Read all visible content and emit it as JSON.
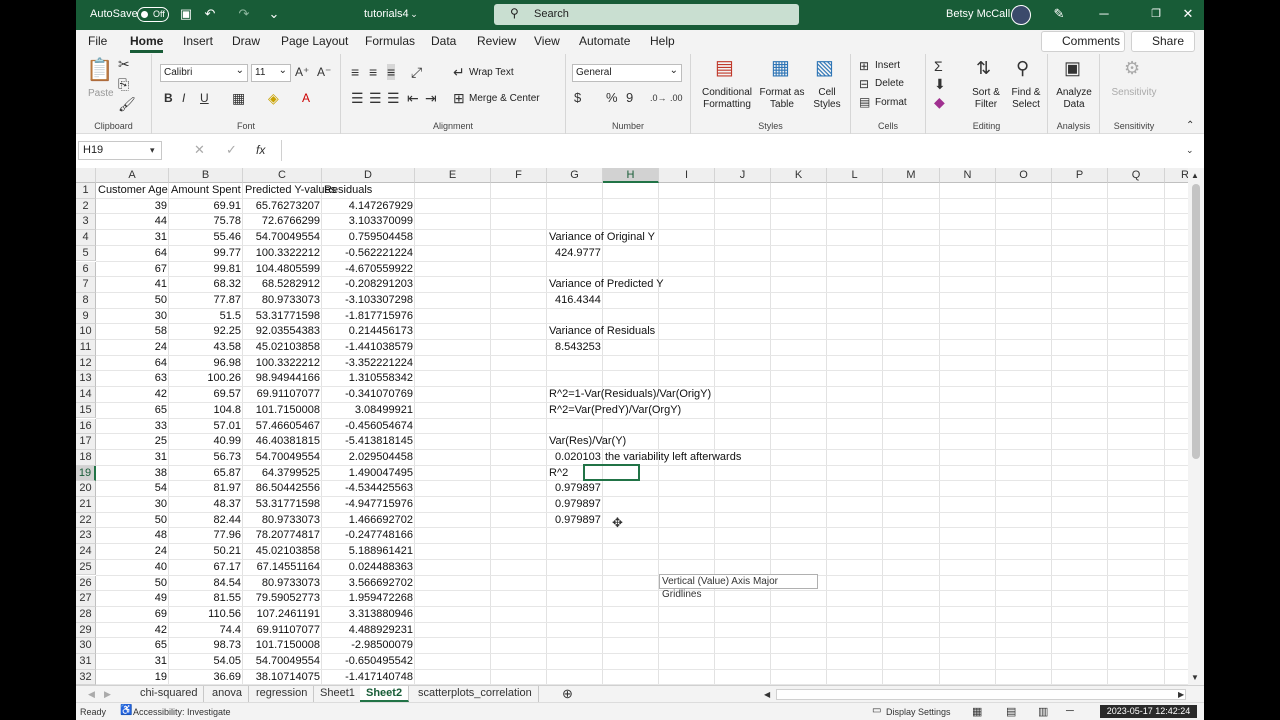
{
  "titlebar": {
    "autosave_label": "AutoSave",
    "autosave_state": "Off",
    "filename": "tutorials4",
    "search_placeholder": "Search",
    "user_name": "Betsy McCall"
  },
  "menu": [
    "File",
    "Home",
    "Insert",
    "Draw",
    "Page Layout",
    "Formulas",
    "Data",
    "Review",
    "View",
    "Automate",
    "Help"
  ],
  "menu_active": "Home",
  "comments_label": "Comments",
  "share_label": "Share",
  "ribbon": {
    "clipboard": {
      "label": "Clipboard",
      "paste": "Paste"
    },
    "font": {
      "label": "Font",
      "name": "Calibri",
      "size": "11"
    },
    "alignment": {
      "label": "Alignment",
      "wrap": "Wrap Text",
      "merge": "Merge & Center"
    },
    "number": {
      "label": "Number",
      "format": "General"
    },
    "styles": {
      "label": "Styles",
      "conditional": "Conditional",
      "conditional2": "Formatting",
      "format_as": "Format as",
      "format_as2": "Table",
      "cell": "Cell",
      "cell2": "Styles"
    },
    "cells": {
      "label": "Cells",
      "insert": "Insert",
      "delete": "Delete",
      "format": "Format"
    },
    "editing": {
      "label": "Editing",
      "sort": "Sort &",
      "sort2": "Filter",
      "find": "Find &",
      "find2": "Select"
    },
    "analysis": {
      "label": "Analysis",
      "analyze": "Analyze",
      "analyze2": "Data"
    },
    "sensitivity": {
      "label": "Sensitivity",
      "btn": "Sensitivity"
    }
  },
  "namebox": "H19",
  "fx": "fx",
  "columns": [
    "A",
    "B",
    "C",
    "D",
    "E",
    "F",
    "G",
    "H",
    "I",
    "J",
    "K",
    "L",
    "M",
    "N",
    "O",
    "P",
    "Q",
    "R"
  ],
  "selected_column": "H",
  "selected_row": 19,
  "rows": [
    "1",
    "2",
    "3",
    "4",
    "5",
    "6",
    "7",
    "8",
    "9",
    "10",
    "11",
    "12",
    "13",
    "14",
    "15",
    "16",
    "17",
    "18",
    "19",
    "20",
    "21",
    "22",
    "23",
    "24",
    "25",
    "26",
    "27",
    "28",
    "29",
    "30",
    "31",
    "32"
  ],
  "headers": [
    "Customer Age",
    "Amount Spent",
    "Predicted Y-values",
    "Residuals"
  ],
  "table": [
    [
      "39",
      "69.91",
      "65.76273207",
      "4.147267929"
    ],
    [
      "44",
      "75.78",
      "72.6766299",
      "3.103370099"
    ],
    [
      "31",
      "55.46",
      "54.70049554",
      "0.759504458"
    ],
    [
      "64",
      "99.77",
      "100.3322212",
      "-0.562221224"
    ],
    [
      "67",
      "99.81",
      "104.4805599",
      "-4.670559922"
    ],
    [
      "41",
      "68.32",
      "68.5282912",
      "-0.208291203"
    ],
    [
      "50",
      "77.87",
      "80.9733073",
      "-3.103307298"
    ],
    [
      "30",
      "51.5",
      "53.31771598",
      "-1.817715976"
    ],
    [
      "58",
      "92.25",
      "92.03554383",
      "0.214456173"
    ],
    [
      "24",
      "43.58",
      "45.02103858",
      "-1.441038579"
    ],
    [
      "64",
      "96.98",
      "100.3322212",
      "-3.352221224"
    ],
    [
      "63",
      "100.26",
      "98.94944166",
      "1.310558342"
    ],
    [
      "42",
      "69.57",
      "69.91107077",
      "-0.341070769"
    ],
    [
      "65",
      "104.8",
      "101.7150008",
      "3.08499921"
    ],
    [
      "33",
      "57.01",
      "57.46605467",
      "-0.456054674"
    ],
    [
      "25",
      "40.99",
      "46.40381815",
      "-5.413818145"
    ],
    [
      "31",
      "56.73",
      "54.70049554",
      "2.029504458"
    ],
    [
      "38",
      "65.87",
      "64.3799525",
      "1.490047495"
    ],
    [
      "54",
      "81.97",
      "86.50442556",
      "-4.534425563"
    ],
    [
      "30",
      "48.37",
      "53.31771598",
      "-4.947715976"
    ],
    [
      "50",
      "82.44",
      "80.9733073",
      "1.466692702"
    ],
    [
      "48",
      "77.96",
      "78.20774817",
      "-0.247748166"
    ],
    [
      "24",
      "50.21",
      "45.02103858",
      "5.188961421"
    ],
    [
      "40",
      "67.17",
      "67.14551164",
      "0.024488363"
    ],
    [
      "50",
      "84.54",
      "80.9733073",
      "3.566692702"
    ],
    [
      "49",
      "81.55",
      "79.59052773",
      "1.959472268"
    ],
    [
      "69",
      "110.56",
      "107.2461191",
      "3.313880946"
    ],
    [
      "42",
      "74.4",
      "69.91107077",
      "4.488929231"
    ],
    [
      "65",
      "98.73",
      "101.7150008",
      "-2.98500079"
    ],
    [
      "31",
      "54.05",
      "54.70049554",
      "-0.650495542"
    ],
    [
      "19",
      "36.69",
      "38.10714075",
      "-1.417140748"
    ]
  ],
  "notes": {
    "var_orig_label": "Variance of Original Y",
    "var_orig_value": "424.9777",
    "var_pred_label": "Variance of Predicted Y",
    "var_pred_value": "416.4344",
    "var_res_label": "Variance of Residuals",
    "var_res_value": "8.543253",
    "formula1": "R^2=1-Var(Residuals)/Var(OrigY)",
    "formula2": "R^2=Var(PredY)/Var(OrgY)",
    "ratio_label": "Var(Res)/Var(Y)",
    "ratio_value": "0.020103",
    "ratio_note": "the variability left afterwards",
    "r2_label": "R^2",
    "r2_values": [
      "0.979897",
      "0.979897",
      "0.979897"
    ]
  },
  "tooltip": "Vertical (Value) Axis Major Gridlines",
  "sheets": [
    "chi-squared",
    "anova",
    "regression",
    "Sheet1",
    "Sheet2",
    "scatterplots_correlation"
  ],
  "active_sheet": "Sheet2",
  "status": {
    "ready": "Ready",
    "accessibility": "Accessibility: Investigate",
    "display": "Display Settings",
    "timestamp": "2023-05-17 12:42:24"
  }
}
